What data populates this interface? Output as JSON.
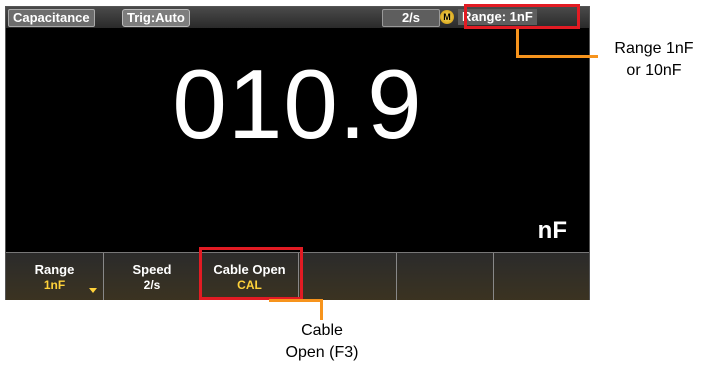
{
  "status": {
    "mode": "Capacitance",
    "trigger": "Trig:Auto",
    "rate": "2/s",
    "auto_icon": "M",
    "range": "Range:  1nF"
  },
  "measurement": {
    "value": "010.9",
    "unit": "nF"
  },
  "softkeys": [
    {
      "label": "Range",
      "value": "1nF"
    },
    {
      "label": "Speed",
      "value": "2/s"
    },
    {
      "label": "Cable Open",
      "value": "CAL"
    },
    {
      "label": "",
      "value": ""
    },
    {
      "label": "",
      "value": ""
    },
    {
      "label": "",
      "value": ""
    }
  ],
  "callouts": {
    "range_line1": "Range 1nF",
    "range_line2": "or 10nF",
    "cable_line1": "Cable",
    "cable_line2": "Open (F3)"
  },
  "colors": {
    "highlight": "#e21b23",
    "callout": "#f7941d",
    "softkey_value": "#ffd23a"
  },
  "icons": {
    "range_dropdown": "chevron-down-icon",
    "auto_mode": "auto-mode-icon"
  }
}
